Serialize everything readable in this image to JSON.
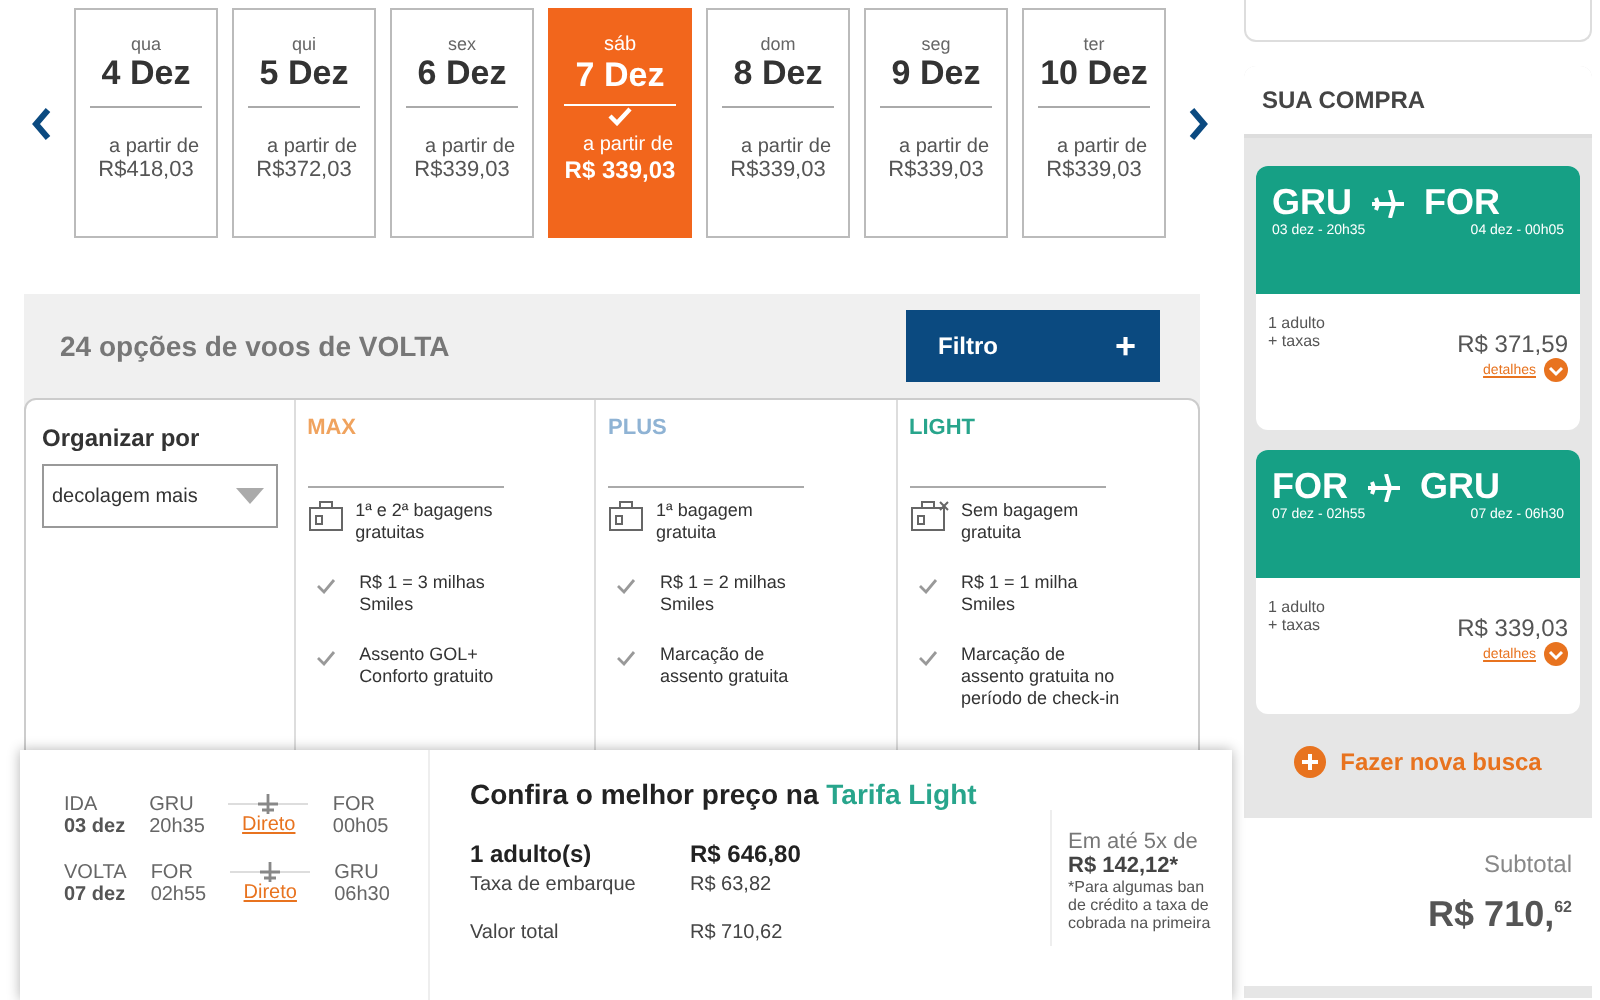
{
  "dates": [
    {
      "weekday": "qua",
      "day": "4 Dez",
      "from_label": "a partir de",
      "price": "R$418,03",
      "selected": false
    },
    {
      "weekday": "qui",
      "day": "5 Dez",
      "from_label": "a partir de",
      "price": "R$372,03",
      "selected": false
    },
    {
      "weekday": "sex",
      "day": "6 Dez",
      "from_label": "a partir de",
      "price": "R$339,03",
      "selected": false
    },
    {
      "weekday": "sáb",
      "day": "7 Dez",
      "from_label": "a partir de",
      "price": "R$ 339,03",
      "selected": true
    },
    {
      "weekday": "dom",
      "day": "8 Dez",
      "from_label": "a partir de",
      "price": "R$339,03",
      "selected": false
    },
    {
      "weekday": "seg",
      "day": "9 Dez",
      "from_label": "a partir de",
      "price": "R$339,03",
      "selected": false
    },
    {
      "weekday": "ter",
      "day": "10 Dez",
      "from_label": "a partir de",
      "price": "R$339,03",
      "selected": false
    }
  ],
  "results_title": "24 opções de voos de VOLTA",
  "filter_button": {
    "label": "Filtro",
    "icon": "+"
  },
  "sort": {
    "label": "Organizar por",
    "value": "decolagem mais"
  },
  "fares": [
    {
      "name": "MAX",
      "color": "#f0a35e",
      "features": [
        {
          "kind": "bag",
          "text": "1ª e 2ª bagagens gratuitas"
        },
        {
          "kind": "check",
          "text": "R$ 1 = 3 milhas Smiles"
        },
        {
          "kind": "check",
          "text": "Assento GOL+ Conforto gratuito"
        }
      ]
    },
    {
      "name": "PLUS",
      "color": "#8fb3d4",
      "features": [
        {
          "kind": "bag",
          "text": "1ª bagagem gratuita"
        },
        {
          "kind": "check",
          "text": "R$ 1 = 2 milhas Smiles"
        },
        {
          "kind": "check",
          "text": "Marcação de assento gratuita"
        }
      ]
    },
    {
      "name": "LIGHT",
      "color": "#28a58c",
      "features": [
        {
          "kind": "no-bag",
          "text": "Sem bagagem gratuita"
        },
        {
          "kind": "check",
          "text": "R$ 1 = 1 milha Smiles"
        },
        {
          "kind": "check",
          "text": "Marcação de assento gratuita no período de check-in"
        }
      ]
    }
  ],
  "popup": {
    "trips": [
      {
        "direction": "IDA",
        "date": "03 dez",
        "origin": "GRU",
        "departure": "20h35",
        "stops": "Direto",
        "destination": "FOR",
        "arrival": "00h05"
      },
      {
        "direction": "VOLTA",
        "date": "07 dez",
        "origin": "FOR",
        "departure": "02h55",
        "stops": "Direto",
        "destination": "GRU",
        "arrival": "06h30"
      }
    ],
    "headline": "Confira o melhor preço na",
    "headline_highlight": "Tarifa Light",
    "lines": [
      {
        "kind": "main",
        "label": "1 adulto(s)",
        "value": "R$ 646,80"
      },
      {
        "kind": "tax",
        "label": "Taxa de embarque",
        "value": "R$ 63,82"
      },
      {
        "kind": "total",
        "label": "Valor total",
        "value": "R$ 710,62"
      }
    ],
    "installments_label": "Em até 5x de",
    "installments_value": "R$ 142,12*",
    "footnote": [
      "*Para algumas ban",
      "de crédito a taxa de",
      "cobrada na primeira"
    ]
  },
  "purchase": {
    "title": "SUA COMPRA",
    "flights": [
      {
        "origin": "GRU",
        "destination": "FOR",
        "departure": "03 dez - 20h35",
        "arrival": "04 dez - 00h05",
        "passengers": "1 adulto",
        "taxes": "+ taxas",
        "price": "R$ 371,59",
        "details": "detalhes"
      },
      {
        "origin": "FOR",
        "destination": "GRU",
        "departure": "07 dez - 02h55",
        "arrival": "07 dez - 06h30",
        "passengers": "1 adulto",
        "taxes": "+ taxas",
        "price": "R$ 339,03",
        "details": "detalhes"
      }
    ],
    "new_search": "Fazer nova busca",
    "subtotal_label": "Subtotal",
    "subtotal_main": "R$ 710,",
    "subtotal_cents": "62"
  }
}
